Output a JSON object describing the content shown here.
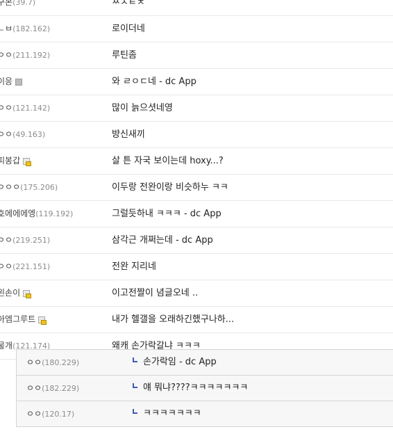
{
  "comments": [
    {
      "nick": "구본",
      "ip": "(39.7)",
      "text": "ㅆㅅㅌㅊ",
      "badge": ""
    },
    {
      "nick": "ㄴㅂ",
      "ip": "(182.162)",
      "text": "로이더네",
      "badge": ""
    },
    {
      "nick": "ㅇㅇ",
      "ip": "(211.192)",
      "text": "루틴좀",
      "badge": ""
    },
    {
      "nick": "이응",
      "ip": "",
      "text": "와 ㄹㅇㄷ네 - dc App",
      "badge": "gray"
    },
    {
      "nick": "ㅇㅇ",
      "ip": "(121.142)",
      "text": "많이 늙으셧네영",
      "badge": ""
    },
    {
      "nick": "ㅇㅇ",
      "ip": "(49.163)",
      "text": "뱡신새끼",
      "badge": ""
    },
    {
      "nick": "피봉갑",
      "ip": "",
      "text": "살 튼 자국 보이는데 hoxy...?",
      "badge": "lock"
    },
    {
      "nick": "ㅇㅇㅇ",
      "ip": "(175.206)",
      "text": "이두랑 전완이랑 비슷하누 ㅋㅋ",
      "badge": ""
    },
    {
      "nick": "호에에에엥",
      "ip": "(119.192)",
      "text": "그럴듯하내 ㅋㅋㅋ - dc App",
      "badge": ""
    },
    {
      "nick": "ㅇㅇ",
      "ip": "(219.251)",
      "text": "삼각근 개쩌는데 - dc App",
      "badge": ""
    },
    {
      "nick": "ㅇㅇ",
      "ip": "(221.151)",
      "text": "전완 지리네",
      "badge": ""
    },
    {
      "nick": "왼손이",
      "ip": "",
      "text": "이고전짤이 념글오네 ..",
      "badge": "lock"
    },
    {
      "nick": "아엠그루트",
      "ip": "",
      "text": "내가 헬갤을 오래하긴했구나하...",
      "badge": "lock"
    },
    {
      "nick": "물개",
      "ip": "(121.174)",
      "text": "왜캐 손가락갈냐 ㅋㅋㅋ",
      "badge": ""
    }
  ],
  "replies": [
    {
      "nick": "ㅇㅇ",
      "ip": "(180.229)",
      "text": "손가락임 - dc App"
    },
    {
      "nick": "ㅇㅇ",
      "ip": "(182.229)",
      "text": "얘 뭐냐????ㅋㅋㅋㅋㅋㅋㅋ"
    },
    {
      "nick": "ㅇㅇ",
      "ip": "(120.17)",
      "text": "ㅋㅋㅋㅋㅋㅋㅋ"
    }
  ],
  "icons": {
    "reply": "reply-arrow-icon",
    "member": "member-badge-icon",
    "lock": "fixed-nick-lock-icon"
  },
  "colors": {
    "reply_bg": "#f7f7f7",
    "reply_arrow": "#3b5bbf",
    "ip_text": "#8c8c8c"
  }
}
